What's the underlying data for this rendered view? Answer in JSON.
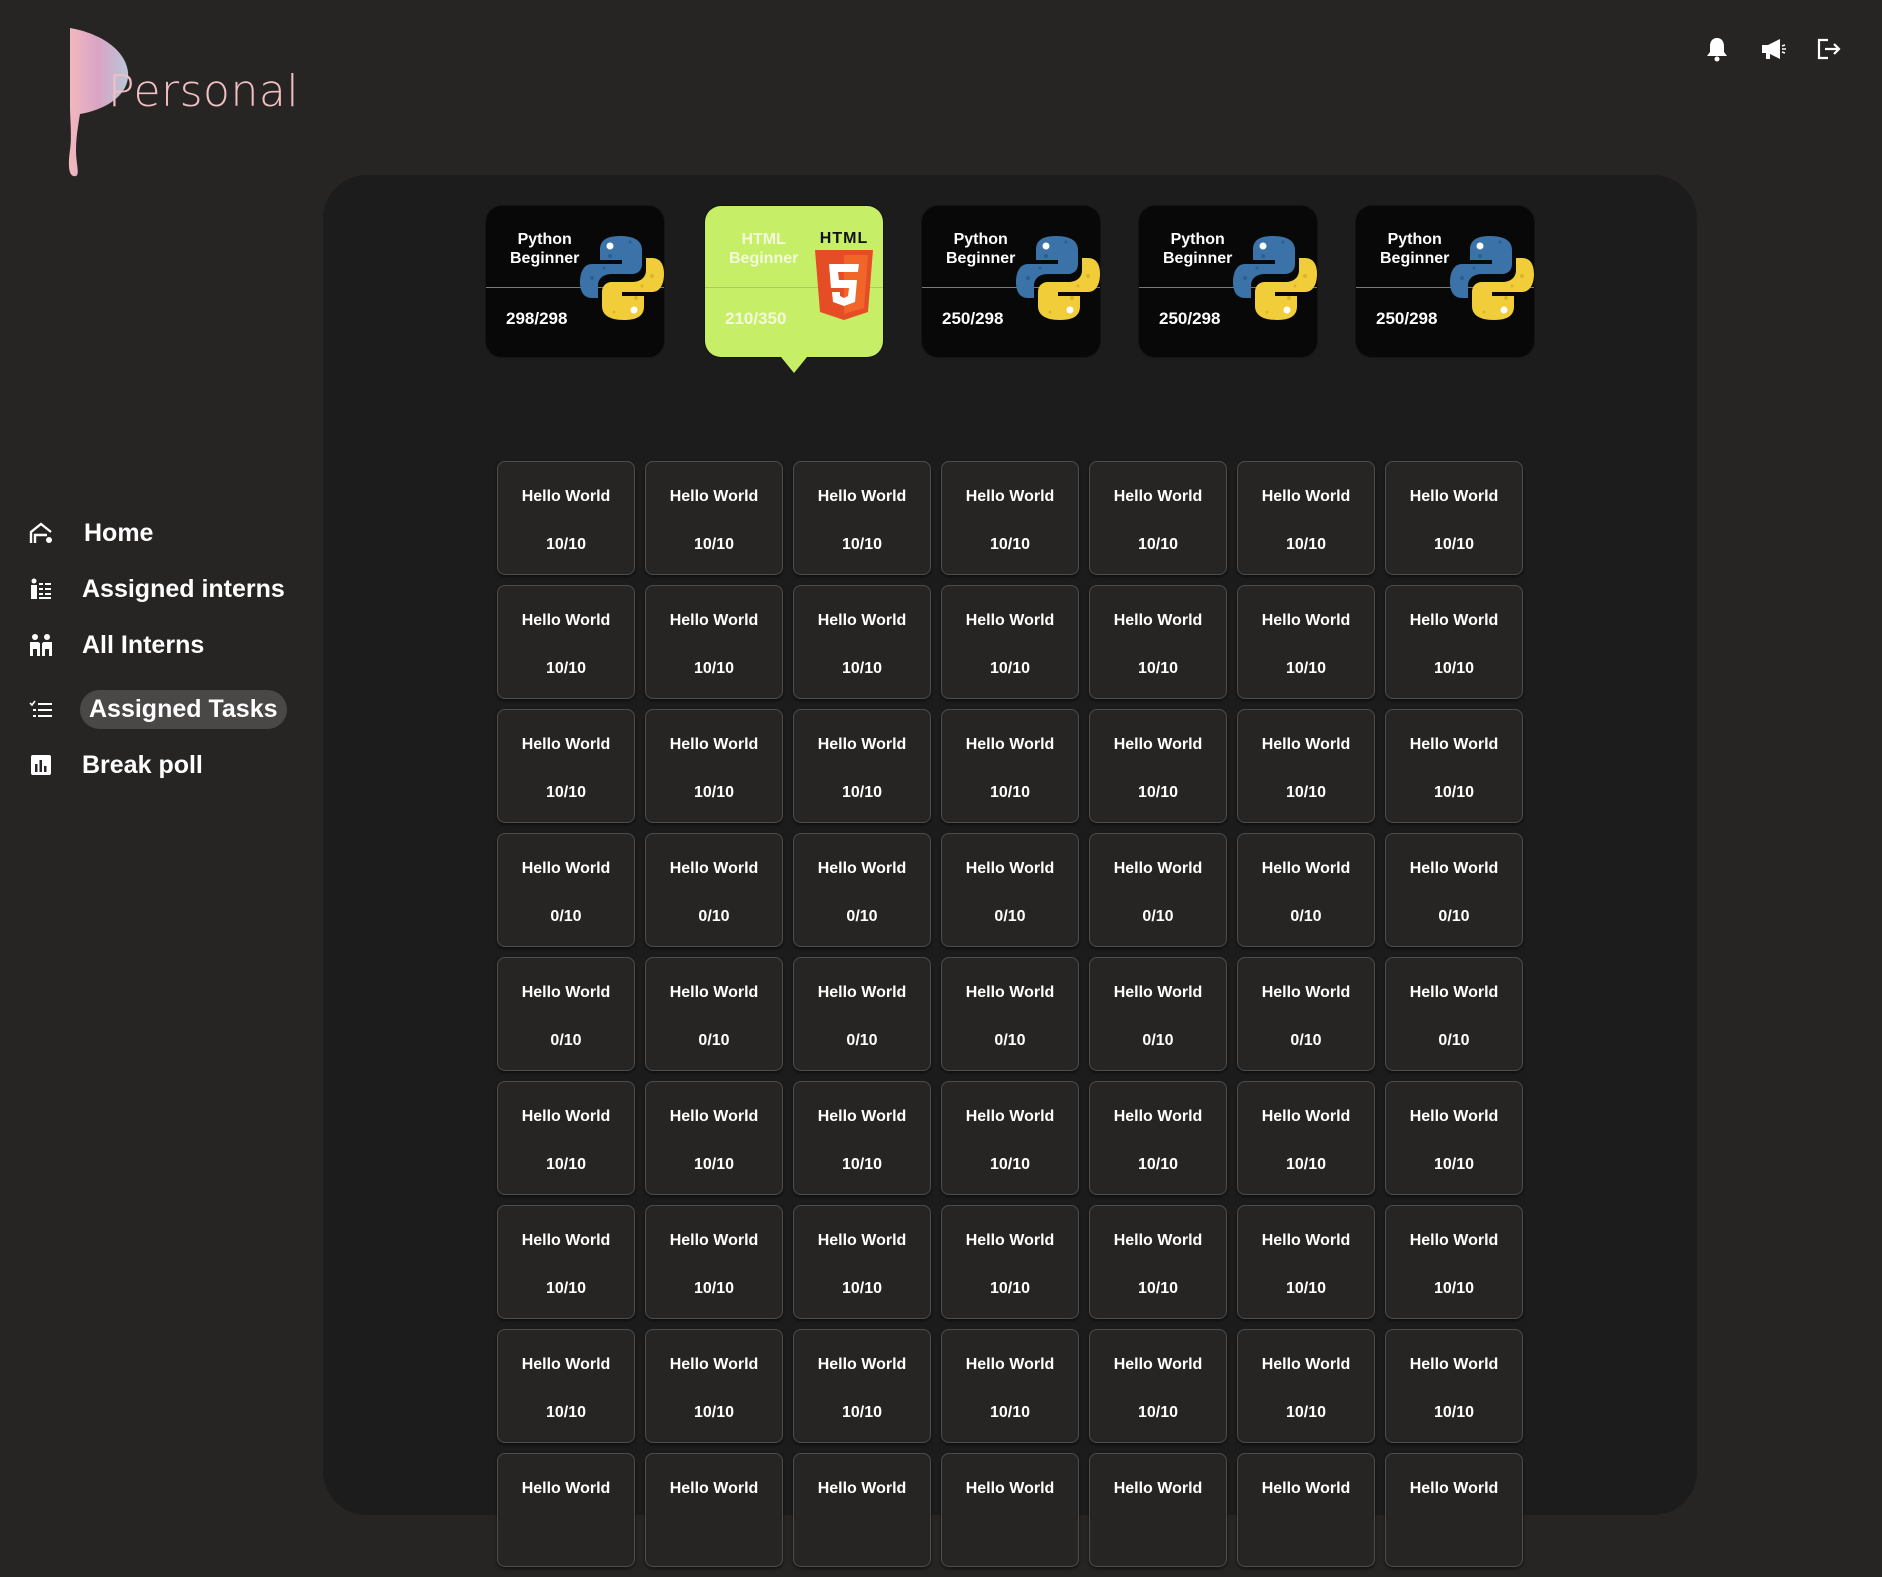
{
  "app": {
    "logo_text": "Personal"
  },
  "top_icons": [
    "bell-icon",
    "megaphone-icon",
    "logout-icon"
  ],
  "nav": [
    {
      "label": "Home",
      "icon": "home-icon",
      "active": false
    },
    {
      "label": "Assigned interns",
      "icon": "assigned-interns-icon",
      "active": false
    },
    {
      "label": "All Interns",
      "icon": "all-interns-icon",
      "active": false
    },
    {
      "label": "Assigned Tasks",
      "icon": "tasks-list-icon",
      "active": true
    },
    {
      "label": "Break poll",
      "icon": "chart-icon",
      "active": false
    }
  ],
  "courses": [
    {
      "title": "Python\nBeginner",
      "progress": "298/298",
      "icon": "python-icon",
      "active": false
    },
    {
      "title": "HTML\nBeginner",
      "progress": "210/350",
      "icon": "html5-icon",
      "active": true
    },
    {
      "title": "Python\nBeginner",
      "progress": "250/298",
      "icon": "python-icon",
      "active": false
    },
    {
      "title": "Python\nBeginner",
      "progress": "250/298",
      "icon": "python-icon",
      "active": false
    },
    {
      "title": "Python\nBeginner",
      "progress": "250/298",
      "icon": "python-icon",
      "active": false
    }
  ],
  "html5_label": "HTML",
  "task_rows": [
    {
      "title": "Hello World",
      "score": "10/10"
    },
    {
      "title": "Hello World",
      "score": "10/10"
    },
    {
      "title": "Hello World",
      "score": "10/10"
    },
    {
      "title": "Hello World",
      "score": "0/10"
    },
    {
      "title": "Hello World",
      "score": "0/10"
    },
    {
      "title": "Hello World",
      "score": "10/10"
    },
    {
      "title": "Hello World",
      "score": "10/10"
    },
    {
      "title": "Hello World",
      "score": "10/10"
    },
    {
      "title": "Hello World",
      "score": ""
    }
  ],
  "tasks_per_row": 7,
  "colors": {
    "background": "#272523",
    "panel": "#1c1c1c",
    "accent": "#c6ee66",
    "logo_text": "#f0c0c4"
  }
}
